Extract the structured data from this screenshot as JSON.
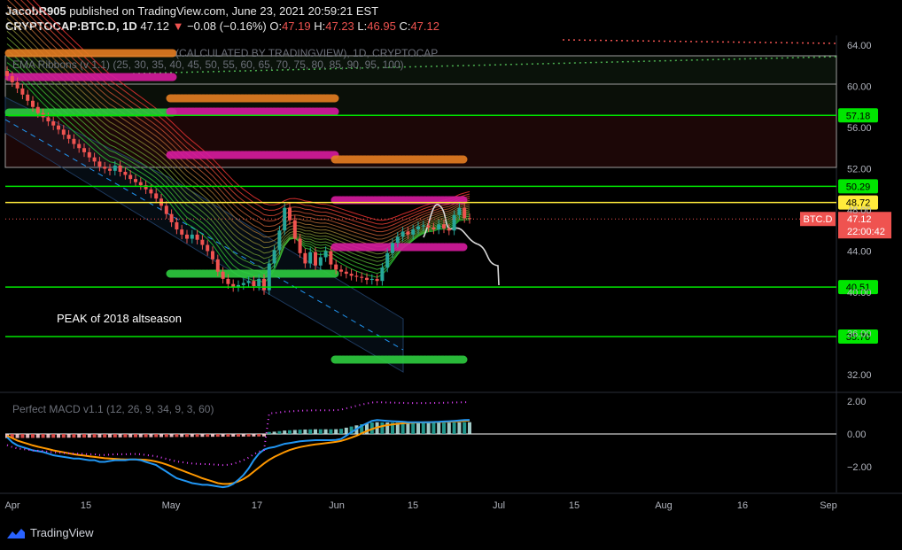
{
  "header": {
    "author": "JacobR905",
    "published_text": "published on TradingView.com, June 23, 2021 20:59:21 EST",
    "symbol": "CRYPTOCAP:BTC.D, 1D",
    "last": "47.12",
    "change": "−0.08 (−0.16%)",
    "o_label": "O:",
    "o": "47.19",
    "h_label": "H:",
    "h": "47.23",
    "l_label": "L:",
    "l": "46.95",
    "c_label": "C:",
    "c": "47.12"
  },
  "indicators": {
    "source_line": "(CALCULATED BY TRADINGVIEW), 1D, CRYPTOCAP",
    "ribbon_line": "EMA Ribbons (v 1.1) (25, 30, 35, 40, 45, 50, 55, 60, 65, 70, 75, 80, 85, 90, 95, 100)",
    "macd_title": "Perfect MACD v1.1 (12, 26, 9, 34, 9, 3, 60)"
  },
  "annotation": "PEAK of 2018 altseason",
  "brand": "TradingView",
  "colors": {
    "up": "#26a69a",
    "down": "#ef5350",
    "level_line": "#00e600",
    "level_yellow": "#ffeb3b",
    "macd_line": "#2196f3",
    "signal_line": "#ff9800"
  },
  "chart_data": {
    "type": "candlestick",
    "ylim": [
      31,
      65
    ],
    "x_ticks": [
      "Apr",
      "15",
      "May",
      "17",
      "Jun",
      "15",
      "Jul",
      "15",
      "Aug",
      "16",
      "Sep"
    ],
    "y_ticks": [
      "64.00",
      "60.00",
      "56.00",
      "52.00",
      "48.00",
      "44.00",
      "40.00",
      "36.00",
      "32.00"
    ],
    "y_tick_values": [
      64,
      60,
      56,
      52,
      48,
      44,
      40,
      36,
      32
    ],
    "levels": [
      {
        "label": "57.18",
        "value": 57.18,
        "color": "#00e600"
      },
      {
        "label": "50.29",
        "value": 50.29,
        "color": "#00e600"
      },
      {
        "label": "48.72",
        "value": 48.72,
        "color": "#ffeb3b"
      },
      {
        "label": "40.51",
        "value": 40.51,
        "color": "#00e600"
      },
      {
        "label": "35.70",
        "value": 35.7,
        "color": "#00e600"
      }
    ],
    "price_tag": {
      "symbol": "BTC.D",
      "value": "47.12",
      "countdown": "22:00:42"
    },
    "closes": [
      61.0,
      60.4,
      59.8,
      59.2,
      58.6,
      58.0,
      57.4,
      57.0,
      56.6,
      56.2,
      55.8,
      55.3,
      54.9,
      54.4,
      54.0,
      53.6,
      53.1,
      52.7,
      52.2,
      52.0,
      51.8,
      52.3,
      51.7,
      51.4,
      51.0,
      50.7,
      50.4,
      50.0,
      49.6,
      49.1,
      48.4,
      47.6,
      46.8,
      46.1,
      45.6,
      45.2,
      45.6,
      45.1,
      44.6,
      44.0,
      43.2,
      42.0,
      41.3,
      40.8,
      40.5,
      40.7,
      40.9,
      41.1,
      40.6,
      41.3,
      40.2,
      42.8,
      44.1,
      46.0,
      48.2,
      47.0,
      45.2,
      43.8,
      42.8,
      43.9,
      42.6,
      43.4,
      44.0,
      42.7,
      42.2,
      42.0,
      41.8,
      41.6,
      41.5,
      41.4,
      41.2,
      41.3,
      41.1,
      42.4,
      43.8,
      44.8,
      45.4,
      45.9,
      45.6,
      46.1,
      46.4,
      46.5,
      46.3,
      46.1,
      46.6,
      46.2,
      46.0,
      47.5,
      48.2,
      47.2,
      47.12
    ],
    "macd_ylim": [
      -3.4,
      2.4
    ],
    "macd_ticks": [
      "2.00",
      "0.00",
      "−2.00"
    ],
    "macd_tick_values": [
      2,
      0,
      -2
    ],
    "macd_line": [
      -0.2,
      -0.5,
      -0.7,
      -0.8,
      -0.9,
      -1.0,
      -1.05,
      -1.1,
      -1.2,
      -1.3,
      -1.35,
      -1.4,
      -1.45,
      -1.5,
      -1.5,
      -1.55,
      -1.6,
      -1.6,
      -1.7,
      -1.7,
      -1.65,
      -1.6,
      -1.6,
      -1.6,
      -1.55,
      -1.55,
      -1.6,
      -1.7,
      -1.8,
      -1.9,
      -2.1,
      -2.3,
      -2.5,
      -2.7,
      -2.8,
      -2.9,
      -3.0,
      -3.05,
      -3.1,
      -3.1,
      -3.15,
      -3.2,
      -3.25,
      -3.2,
      -3.05,
      -2.8,
      -2.5,
      -2.1,
      -1.6,
      -1.2,
      -0.95,
      -0.85,
      -0.8,
      -0.7,
      -0.6,
      -0.55,
      -0.5,
      -0.45,
      -0.42,
      -0.4,
      -0.38,
      -0.38,
      -0.38,
      -0.38,
      -0.36,
      -0.3,
      -0.1,
      0.1,
      0.3,
      0.5,
      0.65,
      0.8,
      0.85,
      0.82,
      0.8,
      0.78,
      0.76,
      0.75,
      0.72,
      0.72,
      0.72,
      0.72,
      0.72,
      0.73,
      0.74,
      0.76,
      0.78,
      0.8,
      0.82,
      0.85,
      0.86
    ],
    "signal_line": [
      -0.1,
      -0.25,
      -0.4,
      -0.5,
      -0.6,
      -0.7,
      -0.78,
      -0.85,
      -0.92,
      -1.0,
      -1.06,
      -1.12,
      -1.18,
      -1.24,
      -1.28,
      -1.32,
      -1.36,
      -1.4,
      -1.44,
      -1.48,
      -1.5,
      -1.52,
      -1.54,
      -1.55,
      -1.55,
      -1.55,
      -1.56,
      -1.58,
      -1.62,
      -1.68,
      -1.76,
      -1.86,
      -1.98,
      -2.1,
      -2.22,
      -2.34,
      -2.46,
      -2.58,
      -2.7,
      -2.8,
      -2.9,
      -3.0,
      -3.05,
      -3.05,
      -3.0,
      -2.9,
      -2.75,
      -2.55,
      -2.3,
      -2.05,
      -1.8,
      -1.58,
      -1.4,
      -1.25,
      -1.1,
      -0.98,
      -0.88,
      -0.8,
      -0.74,
      -0.68,
      -0.64,
      -0.6,
      -0.56,
      -0.52,
      -0.48,
      -0.42,
      -0.33,
      -0.22,
      -0.1,
      0.04,
      0.18,
      0.3,
      0.4,
      0.48,
      0.54,
      0.58,
      0.62,
      0.65,
      0.67,
      0.69,
      0.7,
      0.71,
      0.72,
      0.72,
      0.73,
      0.74,
      0.75,
      0.76,
      0.78,
      0.8,
      0.82
    ]
  }
}
